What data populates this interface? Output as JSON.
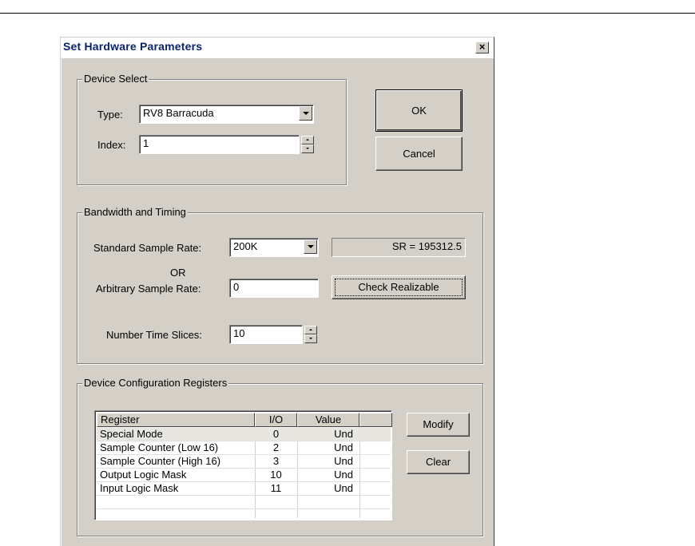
{
  "dialog": {
    "title": "Set Hardware Parameters",
    "close_glyph": "×"
  },
  "device_select": {
    "legend": "Device Select",
    "type_label": "Type:",
    "type_value": "RV8 Barracuda",
    "index_label": "Index:",
    "index_value": "1"
  },
  "buttons": {
    "ok": "OK",
    "cancel": "Cancel",
    "check_realizable": "Check Realizable",
    "modify": "Modify",
    "clear": "Clear"
  },
  "bandwidth": {
    "legend": "Bandwidth and Timing",
    "standard_label": "Standard Sample Rate:",
    "standard_value": "200K",
    "sr_readout": "SR = 195312.5",
    "or_text": "OR",
    "arbitrary_label": "Arbitrary Sample Rate:",
    "arbitrary_value": "0",
    "slices_label": "Number Time Slices:",
    "slices_value": "10"
  },
  "registers": {
    "legend": "Device Configuration Registers",
    "columns": [
      "Register",
      "I/O",
      "Value",
      ""
    ],
    "rows": [
      {
        "register": "Special Mode",
        "io": "0",
        "value": "Und"
      },
      {
        "register": "Sample Counter (Low 16)",
        "io": "2",
        "value": "Und"
      },
      {
        "register": "Sample Counter (High 16)",
        "io": "3",
        "value": "Und"
      },
      {
        "register": "Output Logic Mask",
        "io": "10",
        "value": "Und"
      },
      {
        "register": "Input Logic Mask",
        "io": "11",
        "value": "Und"
      }
    ]
  }
}
